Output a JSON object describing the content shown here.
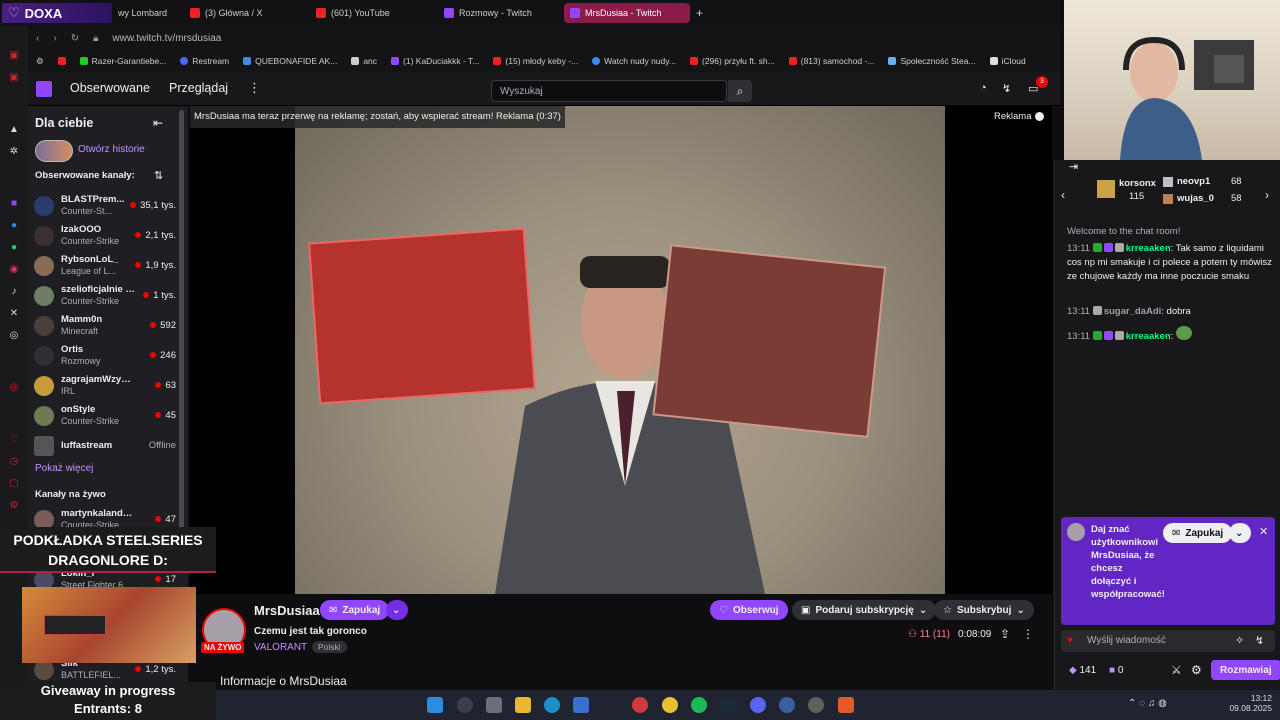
{
  "browser": {
    "tabs": [
      {
        "label": "DOXA",
        "active": false
      },
      {
        "label": "wy Lombard",
        "active": false
      },
      {
        "label": "(3) Główna / X",
        "active": false
      },
      {
        "label": "(601) YouTube",
        "active": false
      },
      {
        "label": "Rozmowy - Twitch",
        "active": false
      },
      {
        "label": "MrsDusiaa - Twitch",
        "active": true
      }
    ],
    "new_tab": "+",
    "url": "www.twitch.tv/mrsdusiaa",
    "bookmarks": [
      "Razer-Garantiebe...",
      "Restream",
      "QUEBONAFIDE AK...",
      "anc",
      "(1) KaDuciakkk - T...",
      "(15) młody keby -...",
      "Watch nudy nudy...",
      "(296) przyłu ft. sh...",
      "(813) samochod -...",
      "Społeczność Stea...",
      "iCloud"
    ]
  },
  "twitch": {
    "nav": {
      "following": "Obserwowane",
      "browse": "Przeglądaj",
      "more": "⋮"
    },
    "search_placeholder": "Wyszukaj",
    "notif_count": "3",
    "sidebar": {
      "for_you": "Dla ciebie",
      "open_history": "Otwórz historie",
      "followed_title": "Obserwowane kanały:",
      "channels": [
        {
          "name": "BLASTPrem...",
          "game": "Counter-St...",
          "viewers": "35,1 tys."
        },
        {
          "name": "IzakOOO",
          "game": "Counter-Strike",
          "viewers": "2,1 tys."
        },
        {
          "name": "RybsonLoL_",
          "game": "League of L...",
          "viewers": "1,9 tys."
        },
        {
          "name": "szelioficjalnie +1",
          "game": "Counter-Strike",
          "viewers": "1 tys."
        },
        {
          "name": "Mamm0n",
          "game": "Minecraft",
          "viewers": "592"
        },
        {
          "name": "Ortis",
          "game": "Rozmowy",
          "viewers": "246"
        },
        {
          "name": "zagrajamWzyci...",
          "game": "IRL",
          "viewers": "63"
        },
        {
          "name": "onStyle",
          "game": "Counter-Strike",
          "viewers": "45"
        },
        {
          "name": "luffastream",
          "game": "",
          "viewers": "Offline"
        }
      ],
      "show_more": "Pokaż więcej",
      "live_title": "Kanały na żywo",
      "live_channels": [
        {
          "name": "martynkalandry...",
          "game": "Counter-Strike",
          "viewers": "47"
        },
        {
          "name": "Lokin_l",
          "game": "Street Fighter 6",
          "viewers": "17"
        },
        {
          "name": "Slik",
          "game": "BATTLEFIEL...",
          "viewers": "1,2 tys."
        }
      ]
    },
    "ad_notice": "MrsDusiaa ma teraz przerwę na reklamę; zostań, aby wspierać stream! Reklama (0:37)",
    "ad_label": "Reklama",
    "stream": {
      "channel": "MrsDusiaa",
      "live_badge": "NA ŻYWO",
      "invite": "Zapukaj",
      "title": "Czemu jest tak goronco",
      "category": "VALORANT",
      "language": "Polski",
      "follow": "Obserwuj",
      "gift_sub": "Podaruj subskrypcję",
      "subscribe": "Subskrybuj",
      "viewers": "11",
      "viewers_paren": "(11)",
      "uptime": "0:08:09",
      "about": "Informacje o MrsDusiaa"
    },
    "chat": {
      "gifters": [
        {
          "name": "korsonx",
          "count": "115"
        },
        {
          "name": "neovp1",
          "count": "68"
        },
        {
          "name": "wujas_0",
          "count": "58"
        }
      ],
      "welcome": "Welcome to the chat room!",
      "messages": [
        {
          "time": "13:11",
          "user": "krreaaken",
          "text": ": Tak samo z liquidami cos np mi smakuje i ci polece a potem ty mówisz ze chujowe każdy ma inne poczucie smaku",
          "color": "#00ff7f"
        },
        {
          "time": "13:11",
          "user": "sugar_daAdi",
          "text": ": dobra",
          "color": "#a0a0a8"
        },
        {
          "time": "13:11",
          "user": "krreaaken",
          "text": ":",
          "color": "#00ff7f"
        }
      ],
      "prompt": {
        "text": "Daj znać użytkownikowi MrsDusiaa, że chcesz dołączyć i współpracować!",
        "button": "Zapukaj"
      },
      "input_placeholder": "Wyślij wiadomość",
      "points": "141",
      "bits": "0",
      "send": "Rozmawiaj"
    }
  },
  "overlay": {
    "title_line1": "PODKŁADKA STEELSERIES",
    "title_line2": "DRAGONLORE D:",
    "giveaway_line1": "Giveaway in progress",
    "giveaway_line2": "Entrants: 8"
  },
  "taskbar": {
    "time": "13:12",
    "date": "09.08.2025"
  },
  "colors": {
    "accent": "#9147ff",
    "live": "#eb0400",
    "tab_active": "#8d1b4a"
  }
}
